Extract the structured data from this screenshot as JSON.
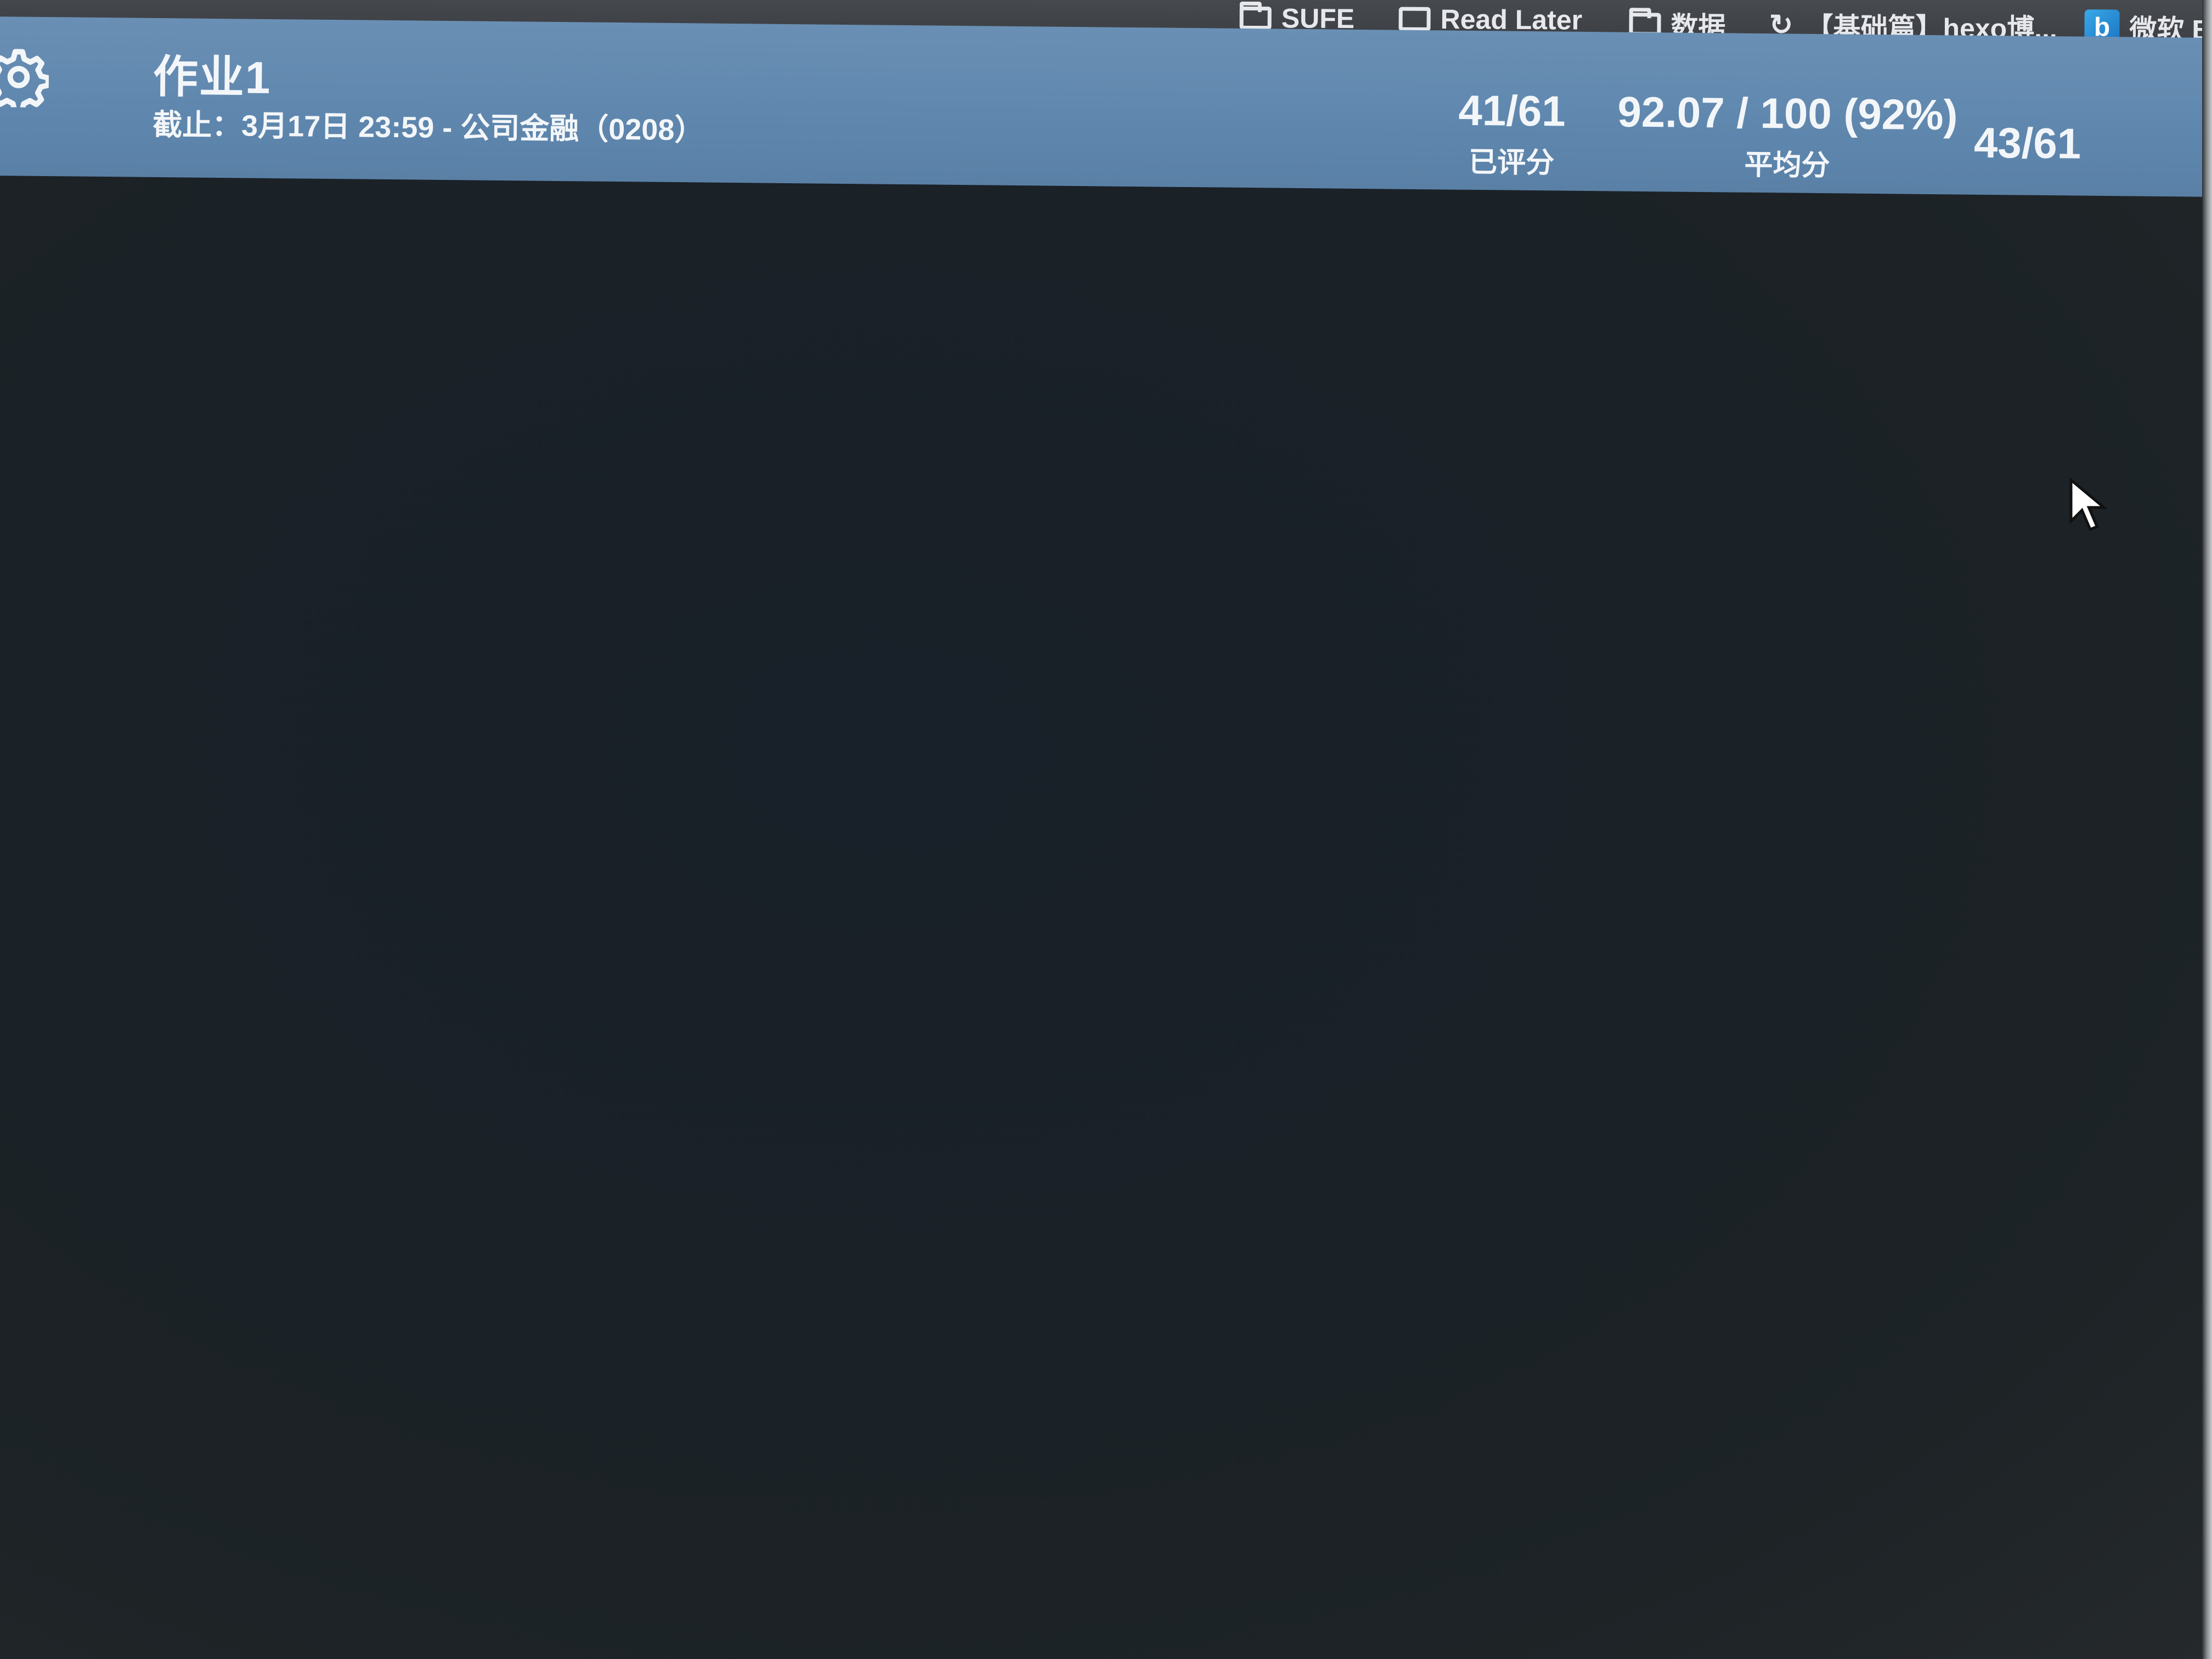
{
  "bookmarks": [
    {
      "label": "SUFE",
      "icon": "folder-icon"
    },
    {
      "label": "Read Later",
      "icon": "tab-icon"
    },
    {
      "label": "数据",
      "icon": "folder-icon"
    },
    {
      "label": "【基础篇】hexo博...",
      "icon": "link-icon"
    },
    {
      "label": "微软 B",
      "icon": "bing-icon"
    }
  ],
  "assignment": {
    "title": "作业1",
    "subtitle": "截止：3月17日 23:59 - 公司金融（0208）"
  },
  "stats": {
    "graded_value": "41/61",
    "graded_label": "已评分",
    "average_value": "92.07 / 100 (92%)",
    "average_label": "平均分",
    "submitted_value": "43/61"
  },
  "colors": {
    "header_bg": "#6a8fb4",
    "content_bg": "#1a2127",
    "text": "#f3f6f9"
  }
}
